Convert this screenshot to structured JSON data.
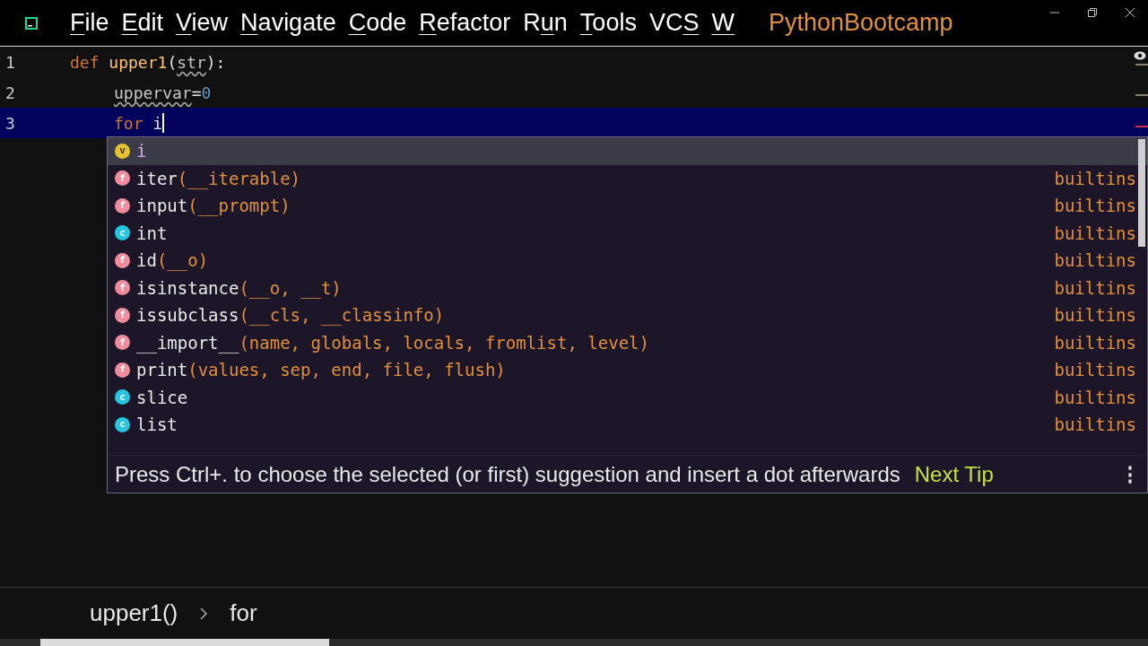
{
  "menu": [
    {
      "key": "F",
      "post": "ile"
    },
    {
      "key": "E",
      "post": "dit"
    },
    {
      "key": "V",
      "post": "iew"
    },
    {
      "key": "N",
      "post": "avigate"
    },
    {
      "key": "C",
      "post": "ode"
    },
    {
      "key": "R",
      "post": "efactor"
    },
    {
      "pre": "R",
      "key": "u",
      "post": "n"
    },
    {
      "key": "T",
      "post": "ools"
    },
    {
      "pre": "VC",
      "key": "S"
    },
    {
      "key": "W"
    }
  ],
  "project": "PythonBootcamp",
  "code_lines": [
    {
      "number": "1",
      "current": false,
      "indented": false,
      "tokens": [
        {
          "kind": "keyword",
          "text": "def "
        },
        {
          "kind": "func",
          "text": "upper1"
        },
        {
          "kind": "plain",
          "text": "("
        },
        {
          "kind": "warn",
          "text": "str"
        },
        {
          "kind": "plain",
          "text": "):"
        }
      ]
    },
    {
      "number": "2",
      "current": false,
      "indented": true,
      "tokens": [
        {
          "kind": "warn",
          "text": "uppervar"
        },
        {
          "kind": "plain",
          "text": "="
        },
        {
          "kind": "number",
          "text": "0"
        }
      ]
    },
    {
      "number": "3",
      "current": true,
      "indented": true,
      "tokens": [
        {
          "kind": "keyword",
          "text": "for "
        },
        {
          "kind": "plain",
          "text": "i"
        }
      ]
    }
  ],
  "completion": {
    "items": [
      {
        "kind": "variable",
        "badge": "v",
        "name": "i",
        "selected": true
      },
      {
        "kind": "function",
        "badge": "f",
        "name": "iter",
        "params": "(__iterable)",
        "source": "builtins",
        "selected": false
      },
      {
        "kind": "function",
        "badge": "f",
        "name": "input",
        "params": "(__prompt)",
        "source": "builtins",
        "selected": false
      },
      {
        "kind": "class",
        "badge": "c",
        "name": "int",
        "source": "builtins",
        "selected": false
      },
      {
        "kind": "function",
        "badge": "f",
        "name": "id",
        "params": "(__o)",
        "source": "builtins",
        "selected": false
      },
      {
        "kind": "function",
        "badge": "f",
        "name": "isinstance",
        "params": "(__o, __t)",
        "source": "builtins",
        "selected": false
      },
      {
        "kind": "function",
        "badge": "f",
        "name": "issubclass",
        "params": "(__cls, __classinfo)",
        "source": "builtins",
        "selected": false
      },
      {
        "kind": "function",
        "badge": "f",
        "name": "__import__",
        "params": "(name, globals, locals, fromlist, level)",
        "source": "builtins",
        "selected": false
      },
      {
        "kind": "function",
        "badge": "f",
        "name": "print",
        "params": "(values, sep, end, file, flush)",
        "source": "builtins",
        "selected": false
      },
      {
        "kind": "class",
        "badge": "c",
        "name": "slice",
        "source": "builtins",
        "selected": false
      },
      {
        "kind": "class",
        "badge": "c",
        "name": "list",
        "source": "builtins",
        "selected": false
      }
    ],
    "tip": "Press Ctrl+. to choose the selected (or first) suggestion and insert a dot afterwards",
    "next_tip": "Next Tip",
    "more": "⋮"
  },
  "breadcrumbs": [
    "upper1()",
    "for"
  ]
}
